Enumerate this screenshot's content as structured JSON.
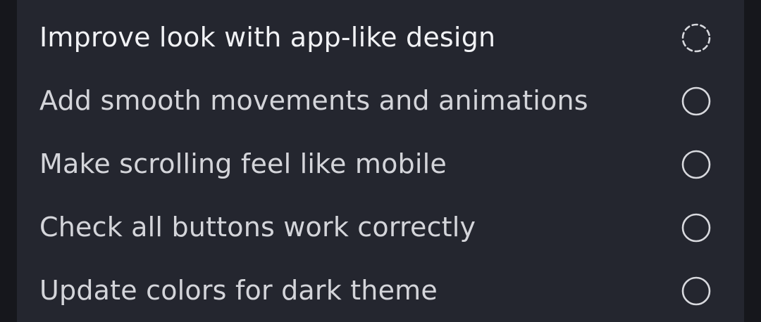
{
  "colors": {
    "page_bg": "#16171c",
    "panel_bg": "#24262f",
    "text_primary": "#f1f2f5",
    "text_secondary": "#d4d5da",
    "icon_stroke": "#d8d9de"
  },
  "tasks": [
    {
      "label": "Improve look with app-like design",
      "status": "in-progress",
      "icon": "dashed-circle-icon"
    },
    {
      "label": "Add smooth movements and animations",
      "status": "pending",
      "icon": "empty-circle-icon"
    },
    {
      "label": "Make scrolling feel like mobile",
      "status": "pending",
      "icon": "empty-circle-icon"
    },
    {
      "label": "Check all buttons work correctly",
      "status": "pending",
      "icon": "empty-circle-icon"
    },
    {
      "label": "Update colors for dark theme",
      "status": "pending",
      "icon": "empty-circle-icon"
    }
  ]
}
